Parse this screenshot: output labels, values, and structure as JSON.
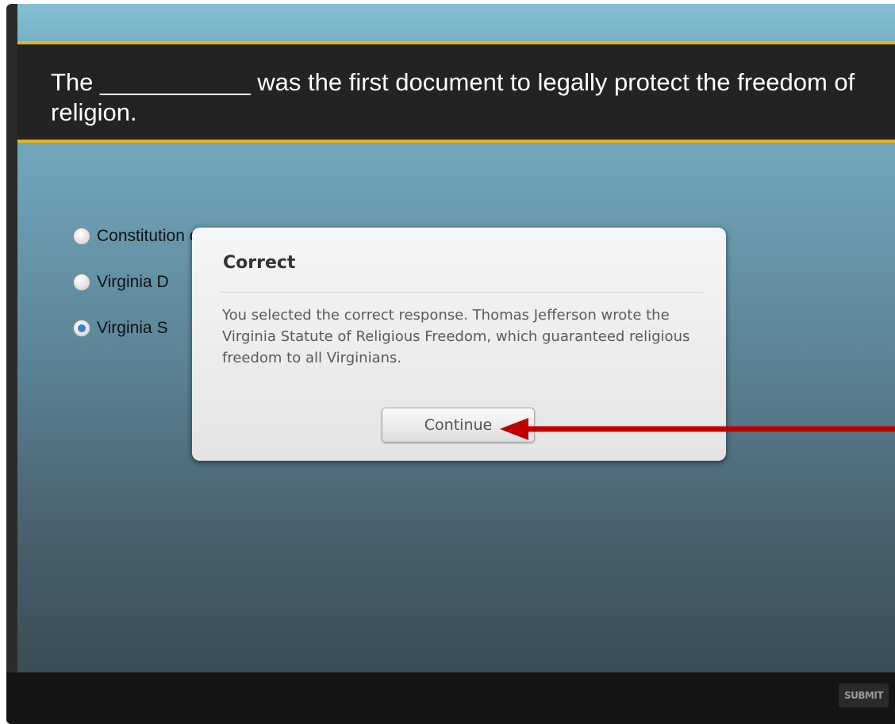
{
  "question": {
    "text": "The ___________ was the first document to legally protect the freedom of religion."
  },
  "options": [
    {
      "label": "Constitution of Virginia",
      "selected": false
    },
    {
      "label": "Virginia D",
      "selected": false
    },
    {
      "label": "Virginia S",
      "selected": true
    }
  ],
  "dialog": {
    "title": "Correct",
    "message": "You selected the correct response. Thomas Jefferson wrote the Virginia Statute of  Religious Freedom, which guaranteed religious freedom to all Virginians.",
    "continue_label": "Continue"
  },
  "footer": {
    "submit_label": "SUBMIT"
  },
  "colors": {
    "accent_bar": "#e7b21f",
    "annotation_arrow": "#c00000",
    "radio_selected": "#3d7ed6"
  },
  "icons": {
    "annotation": "red-arrow-icon"
  }
}
